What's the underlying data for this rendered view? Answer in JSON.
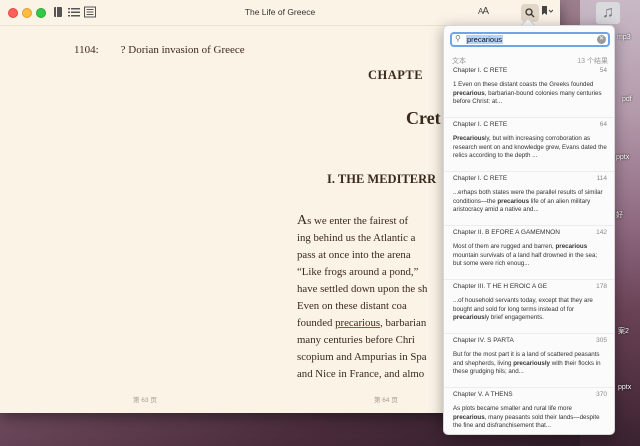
{
  "window": {
    "title": "The Life of Greece"
  },
  "toolbar": {
    "font_label": "AA",
    "search_icon": "search-icon",
    "bookmark_icon": "bookmark-icon"
  },
  "book": {
    "ref_number": "1104:",
    "ref_text": "? Dorian invasion of Greece",
    "chapter_heading": "CHAPTE",
    "chapter_title": "Cret",
    "section_title": "I. THE MEDITERR",
    "lines": [
      "ing behind us the Atlantic a",
      "pass at once into the arena",
      "“Like frogs around a pond,”",
      "have settled down upon the sh",
      "Even on these distant coa",
      "many centuries before Chri",
      "scopium and Ampurias in Spa",
      "and Nice in France, and almo"
    ],
    "first_line_dropcap": "A",
    "first_line_rest": "s we enter the fairest of",
    "founded_line": {
      "before": "founded ",
      "highlight": "precarious",
      "after": ", barbarian"
    },
    "page_left": "第 63 页",
    "page_right": "第 64 页"
  },
  "search": {
    "query": "precarious",
    "section_label": "文本",
    "result_count": "13 个结果",
    "results": [
      {
        "chapter": "Chapter I. C RETE",
        "page": "54",
        "pre": "1 Even on these distant coasts the Greeks founded ",
        "hit": "precarious",
        "post": ", barbarian-bound colonies many centuries before Christ: at..."
      },
      {
        "chapter": "Chapter I. C RETE",
        "page": "64",
        "pre": "",
        "hit": "Precarious",
        "post": "ly, but with increasing corroboration as research went on and knowledge grew, Evans dated the relics according to the depth ..."
      },
      {
        "chapter": "Chapter I. C RETE",
        "page": "114",
        "pre": "...erhaps both states were the parallel results of similar conditions—the ",
        "hit": "precarious",
        "post": " life of an alien military aristocracy amid a native and..."
      },
      {
        "chapter": "Chapter II. B EFORE A GAMEMNON",
        "page": "142",
        "pre": "Most of them are rugged and barren, ",
        "hit": "precarious",
        "post": " mountain survivals of a land half drowned in the sea; but some were rich enoug..."
      },
      {
        "chapter": "Chapter III. T HE H EROIC A GE",
        "page": "178",
        "pre": "...of household servants today, except that they are bought and sold for long terms instead of for ",
        "hit": "precarious",
        "post": "ly brief engagements."
      },
      {
        "chapter": "Chapter IV. S PARTA",
        "page": "305",
        "pre": "But for the most part it is a land of scattered peasants and shepherds, living ",
        "hit": "precariously",
        "post": " with their flocks in these grudging hils; and..."
      },
      {
        "chapter": "Chapter V. A THENS",
        "page": "370",
        "pre": "As plots became smaller and rural life more ",
        "hit": "precarious",
        "post": ", many peasants sold their lands—despite the fine and disfranchisement that..."
      }
    ]
  },
  "desktop": {
    "labels": [
      "mp3",
      "pdf",
      "pptx",
      "好",
      "案2",
      "pptx"
    ]
  }
}
